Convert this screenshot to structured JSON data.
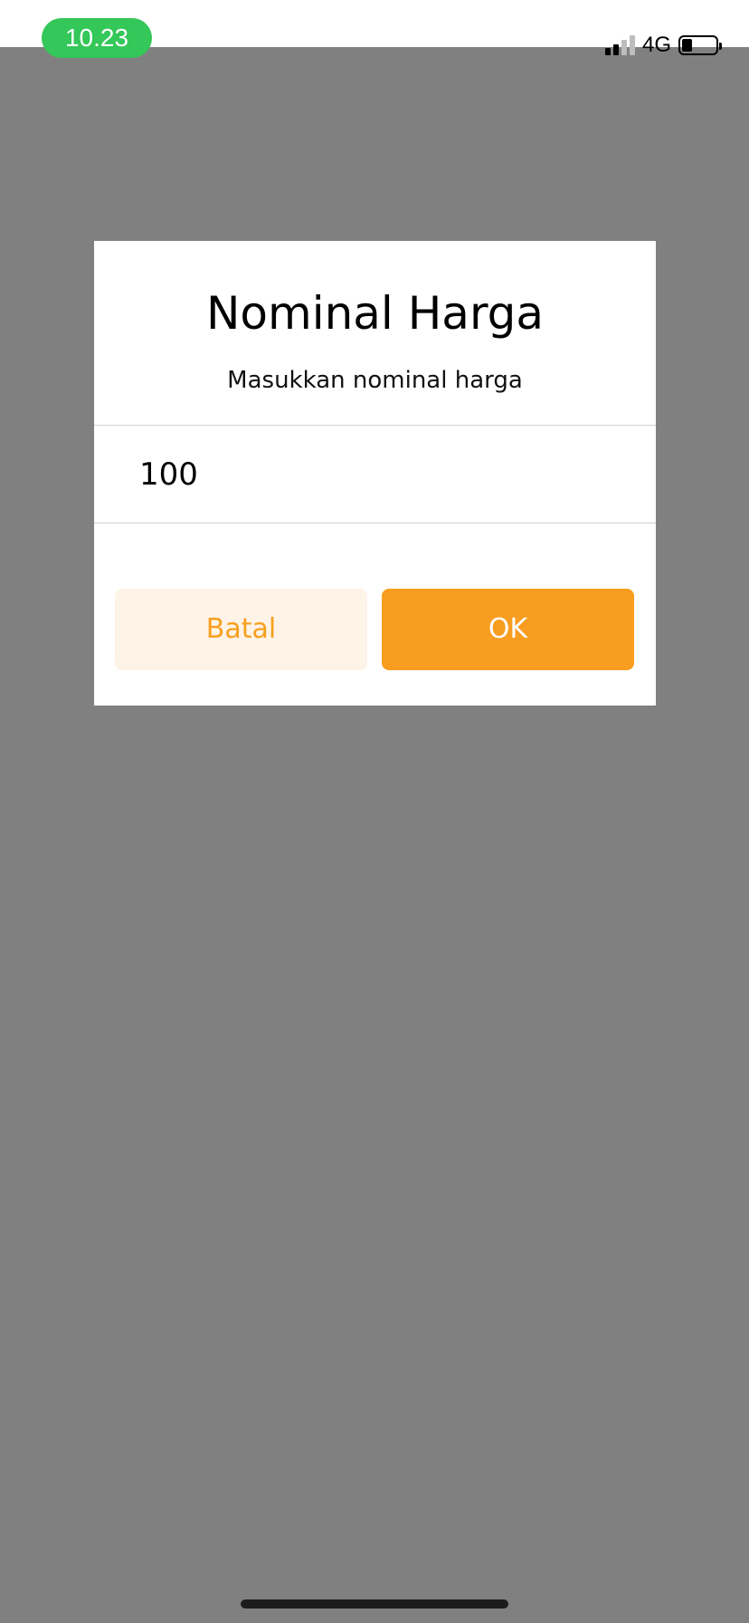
{
  "status_bar": {
    "time": "10.23",
    "network": "4G",
    "battery_level": 0.3
  },
  "dialog": {
    "title": "Nominal Harga",
    "subtitle": "Masukkan nominal harga",
    "input_value": "100",
    "cancel_label": "Batal",
    "ok_label": "OK"
  },
  "colors": {
    "accent": "#f89d20",
    "accent_light": "#fef3e7",
    "overlay": "#808080",
    "time_pill": "#34c759"
  },
  "icons": [
    "signal-icon",
    "battery-icon"
  ]
}
